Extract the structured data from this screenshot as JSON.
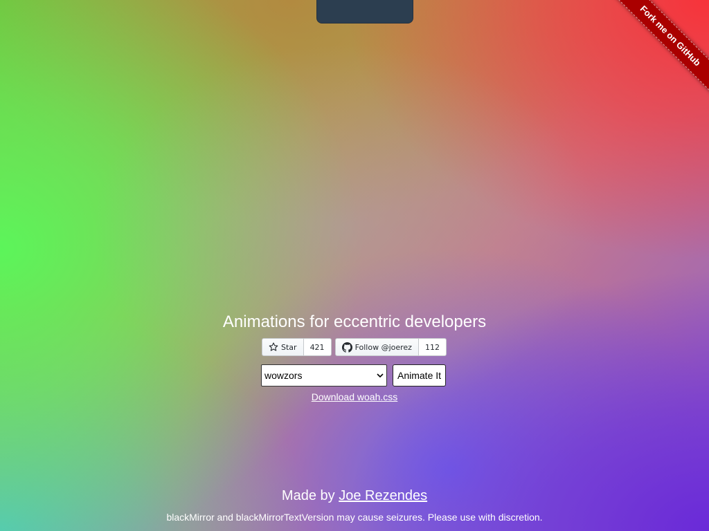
{
  "ribbon": {
    "label": "Fork me on GitHub",
    "color": "#aa0000"
  },
  "tagline": "Animations for eccentric developers",
  "github": {
    "star": {
      "label": "Star",
      "count": "421",
      "icon": "star-icon"
    },
    "follow": {
      "label": "Follow @joerez",
      "count": "112",
      "icon": "github-icon"
    }
  },
  "controls": {
    "animation_select": {
      "value": "wowzors",
      "icon": "chevron-down-icon"
    },
    "animate_button": "Animate It"
  },
  "download_link": "Download woah.css",
  "footer": {
    "made_by_prefix": "Made by",
    "author_link": "Joe Rezendes",
    "warning": "blackMirror and blackMirrorTextVersion may cause seizures. Please use with discretion."
  }
}
